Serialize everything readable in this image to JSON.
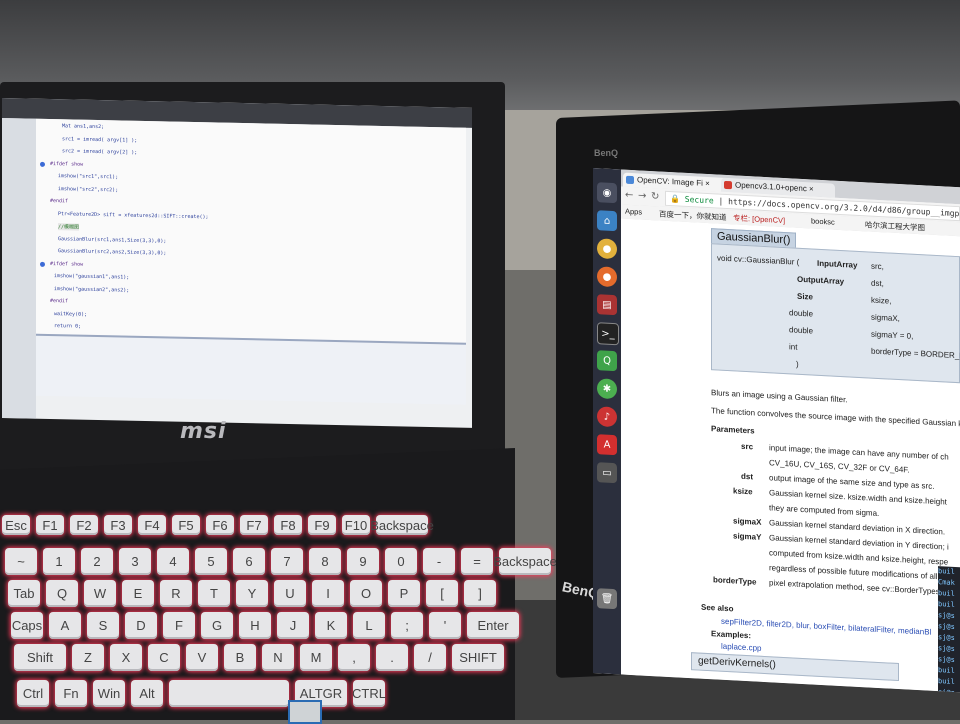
{
  "laptop": {
    "brand": "msi",
    "code_lines": [
      "Mat ans1,ans2;",
      "src1 = imread( argv[1] );",
      "src2 = imread( argv[2] );",
      "#ifdef show",
      "imshow(\"src1\",src1);",
      "imshow(\"src2\",src2);",
      "#endif",
      "Ptr<Feature2D> sift = xfeatures2d::SIFT::create();",
      "//模糊图",
      "GaussianBlur(src1,ans1,Size(3,3),0);",
      "GaussianBlur(src2,ans2,Size(3,3),0);",
      "#ifdef show",
      "imshow(\"gaussian1\",ans1);",
      "imshow(\"gaussian2\",ans2);",
      "#endif",
      "waitKey(0);",
      "return 0;"
    ],
    "keyboard_rows": [
      [
        "Esc",
        "F1",
        "F2",
        "F3",
        "F4",
        "F5",
        "F6",
        "F7",
        "F8",
        "F9",
        "F10",
        "Backspace"
      ],
      [
        "~",
        "1",
        "2",
        "3",
        "4",
        "5",
        "6",
        "7",
        "8",
        "9",
        "0",
        "-",
        "=",
        "Backspace"
      ],
      [
        "Tab",
        "Q",
        "W",
        "E",
        "R",
        "T",
        "Y",
        "U",
        "I",
        "O",
        "P",
        "[",
        "]"
      ],
      [
        "Caps",
        "A",
        "S",
        "D",
        "F",
        "G",
        "H",
        "J",
        "K",
        "L",
        ";",
        "'",
        "Enter"
      ],
      [
        "Shift",
        "Z",
        "X",
        "C",
        "V",
        "B",
        "N",
        "M",
        ",",
        ".",
        "/",
        "SHIFT"
      ],
      [
        "Ctrl",
        "Fn",
        "Win",
        "Alt",
        "",
        "ALTGR",
        "CTRL"
      ]
    ]
  },
  "monitor": {
    "brand_top": "BenQ",
    "brand_bottom": "BenQ",
    "tabs": [
      {
        "label": "OpenCV: Image Fi ×",
        "favicon_color": "#4a88d8"
      },
      {
        "label": "Opencv3.1.0+openc ×",
        "favicon_color": "#d43b2f"
      }
    ],
    "url_secure": "Secure",
    "url": "https://docs.opencv.org/3.2.0/d4/d86/group__imgproc__",
    "bookmarks": [
      "Apps",
      "百度一下，你就知道",
      "专栏: [OpenCV]",
      "booksc",
      "哈尔滨工程大学图"
    ],
    "function_heading": "GaussianBlur()",
    "signature": [
      {
        "type": "void cv::GaussianBlur (",
        "name": "InputArray",
        "param": "src,"
      },
      {
        "type": "",
        "name": "OutputArray",
        "param": "dst,"
      },
      {
        "type": "",
        "name": "Size",
        "param": "ksize,"
      },
      {
        "type": "",
        "name": "double",
        "param": "sigmaX,"
      },
      {
        "type": "",
        "name": "double",
        "param": "sigmaY = 0,"
      },
      {
        "type": "",
        "name": "int",
        "param": "borderType = BORDER_DEFAULT"
      },
      {
        "type": ")",
        "name": "",
        "param": ""
      }
    ],
    "description": "Blurs an image using a Gaussian filter.",
    "description2": "The function convolves the source image with the specified Gaussian k",
    "parameters_label": "Parameters",
    "params": [
      {
        "name": "src",
        "text": "input image; the image can have any number of ch"
      },
      {
        "name": "",
        "text": "CV_16U, CV_16S, CV_32F or CV_64F."
      },
      {
        "name": "dst",
        "text": "output image of the same size and type as src."
      },
      {
        "name": "ksize",
        "text": "Gaussian kernel size. ksize.width and ksize.height"
      },
      {
        "name": "",
        "text": "they are computed from sigma."
      },
      {
        "name": "sigmaX",
        "text": "Gaussian kernel standard deviation in X direction."
      },
      {
        "name": "sigmaY",
        "text": "Gaussian kernel standard deviation in Y direction; i"
      },
      {
        "name": "",
        "text": "computed from ksize.width and ksize.height, respe"
      },
      {
        "name": "",
        "text": "regardless of possible future modifications of all this"
      },
      {
        "name": "borderType",
        "text": "pixel extrapolation method, see cv::BorderTypes"
      }
    ],
    "see_also_label": "See also",
    "see_also": "sepFilter2D, filter2D, blur, boxFilter, bilateralFilter, medianBl",
    "examples_label": "Examples:",
    "examples": "laplace.cpp",
    "next_heading": "getDerivKernels()",
    "terminal_lines": [
      "buil",
      "Cmak",
      "buil",
      "buil",
      "sj@s",
      "sj@s",
      "sj@s",
      "sj@s",
      "sj@s",
      "buil",
      "buil",
      "sj@s"
    ]
  }
}
